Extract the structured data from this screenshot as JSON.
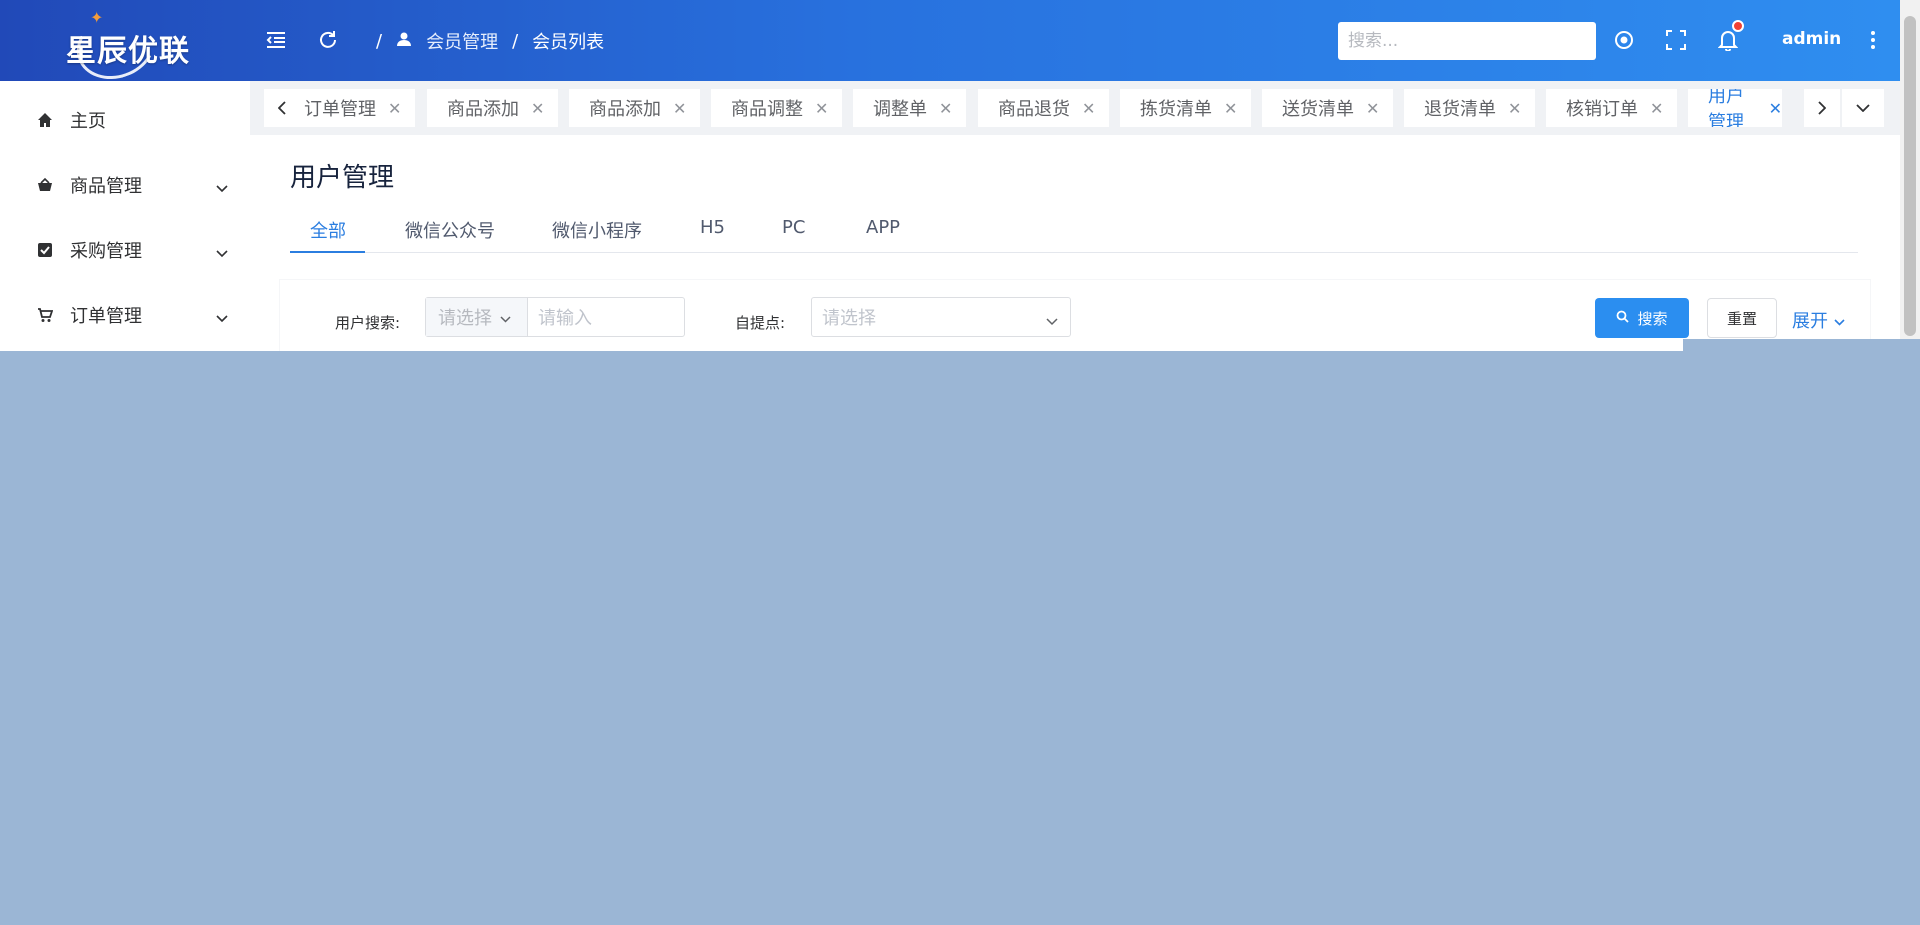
{
  "logo": {
    "text": "星辰优联"
  },
  "header": {
    "breadcrumb": {
      "sep1": "/",
      "parent": "会员管理",
      "sep2": "/",
      "current": "会员列表"
    },
    "search_placeholder": "搜索...",
    "user": "admin",
    "notification_dot_color": "#f04134"
  },
  "sidebar": {
    "items": [
      {
        "label": "主页",
        "icon": "home-icon"
      },
      {
        "label": "商品管理",
        "icon": "basket-icon"
      },
      {
        "label": "采购管理",
        "icon": "checkbox-icon"
      },
      {
        "label": "订单管理",
        "icon": "cart-icon"
      }
    ]
  },
  "tabs": [
    {
      "label": "订单管理"
    },
    {
      "label": "商品添加"
    },
    {
      "label": "商品添加"
    },
    {
      "label": "商品调整"
    },
    {
      "label": "调整单"
    },
    {
      "label": "商品退货"
    },
    {
      "label": "拣货清单"
    },
    {
      "label": "送货清单"
    },
    {
      "label": "退货清单"
    },
    {
      "label": "核销订单"
    },
    {
      "label": "用户管理",
      "active": true
    }
  ],
  "page": {
    "title": "用户管理",
    "sub_tabs": [
      "全部",
      "微信公众号",
      "微信小程序",
      "H5",
      "PC",
      "APP"
    ],
    "active_sub_tab": "全部"
  },
  "filter": {
    "user_search_label": "用户搜索:",
    "user_search_select_placeholder": "请选择",
    "user_search_input_placeholder": "请输入",
    "pickup_label": "自提点:",
    "pickup_placeholder": "请选择",
    "search_button": "搜索",
    "reset_button": "重置",
    "expand_link": "展开"
  },
  "colors": {
    "accent": "#2b7ee0",
    "header_gradient_start": "#2149b8",
    "header_gradient_end": "#2f8ef0",
    "overlay": "#9bb6d5"
  }
}
